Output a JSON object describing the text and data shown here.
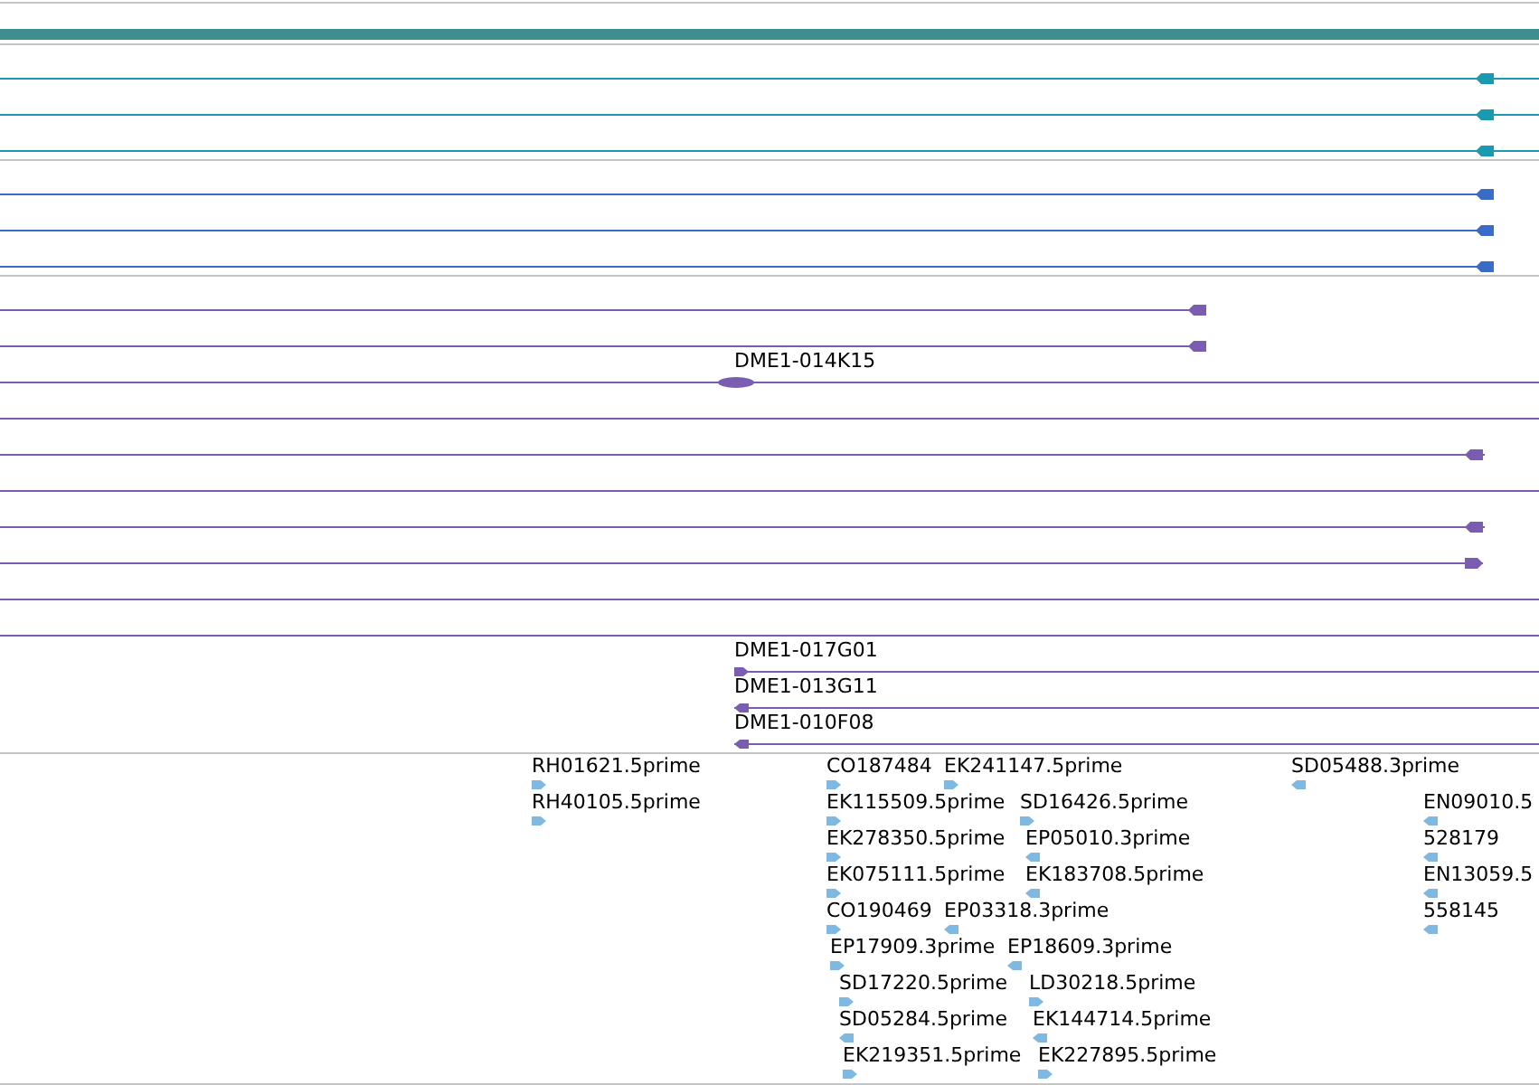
{
  "tracks": [
    {
      "kind": "bar",
      "color": "#3e8e8e"
    },
    {
      "kind": "rows",
      "color": "#1a9ab0",
      "rows": [
        {
          "kind": "arrow",
          "reverse": true
        },
        {
          "kind": "arrow",
          "reverse": true
        },
        {
          "kind": "arrow",
          "reverse": true
        }
      ]
    },
    {
      "kind": "rows",
      "color": "#3a6bc8",
      "rows": [
        {
          "kind": "arrow",
          "reverse": true
        },
        {
          "kind": "arrow",
          "reverse": true
        },
        {
          "kind": "arrow",
          "reverse": true
        }
      ]
    },
    {
      "kind": "rows",
      "color": "#7a5cb0",
      "rows": [
        {
          "kind": "arrow",
          "reverse": true
        },
        {
          "kind": "arrow",
          "reverse": true
        },
        {
          "kind": "glyph",
          "label": "DME1-014K15"
        },
        {
          "kind": "line"
        },
        {
          "kind": "arrow",
          "reverse": true
        },
        {
          "kind": "line"
        },
        {
          "kind": "arrow",
          "reverse": true
        },
        {
          "kind": "arrow",
          "reverse": false
        },
        {
          "kind": "line"
        },
        {
          "kind": "line"
        },
        {
          "kind": "arrow",
          "reverse": false,
          "label": "DME1-017G01"
        },
        {
          "kind": "arrow",
          "reverse": true,
          "label": "DME1-013G11"
        },
        {
          "kind": "arrow",
          "reverse": true,
          "label": "DME1-010F08"
        }
      ]
    },
    {
      "kind": "labels",
      "color": "#7fb8e0",
      "rows": [
        [
          {
            "label": "RH01621.5prime",
            "reverse": false
          },
          {
            "label": "CO187484",
            "reverse": false
          },
          {
            "label": "EK241147.5prime",
            "reverse": false
          },
          {
            "label": "SD05488.3prime",
            "reverse": true
          }
        ],
        [
          {
            "label": "RH40105.5prime",
            "reverse": false
          },
          {
            "label": "EK115509.5prime",
            "reverse": false
          },
          {
            "label": "SD16426.5prime",
            "reverse": false
          },
          {
            "label": "EN09010.5",
            "reverse": true
          }
        ],
        [
          {
            "label": "EK278350.5prime",
            "reverse": false
          },
          {
            "label": "EP05010.3prime",
            "reverse": true
          },
          {
            "label": "528179",
            "reverse": true
          }
        ],
        [
          {
            "label": "EK075111.5prime",
            "reverse": false
          },
          {
            "label": "EK183708.5prime",
            "reverse": true
          },
          {
            "label": "EN13059.5",
            "reverse": true
          }
        ],
        [
          {
            "label": "CO190469",
            "reverse": false
          },
          {
            "label": "EP03318.3prime",
            "reverse": true
          },
          {
            "label": "558145",
            "reverse": true
          }
        ],
        [
          {
            "label": "EP17909.3prime",
            "reverse": false
          },
          {
            "label": "EP18609.3prime",
            "reverse": true
          }
        ],
        [
          {
            "label": "SD17220.5prime",
            "reverse": false
          },
          {
            "label": "LD30218.5prime",
            "reverse": false
          }
        ],
        [
          {
            "label": "SD05284.5prime",
            "reverse": true
          },
          {
            "label": "EK144714.5prime",
            "reverse": true
          }
        ],
        [
          {
            "label": "EK219351.5prime",
            "reverse": false
          },
          {
            "label": "EK227895.5prime",
            "reverse": false
          }
        ]
      ]
    }
  ]
}
